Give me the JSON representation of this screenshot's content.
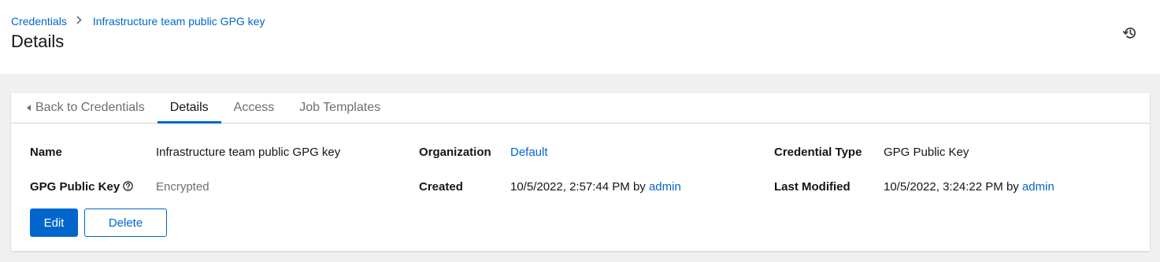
{
  "breadcrumb": {
    "root": "Credentials",
    "current": "Infrastructure team public GPG key"
  },
  "page_title": "Details",
  "tabs": [
    {
      "label": "Back to Credentials",
      "active": false
    },
    {
      "label": "Details",
      "active": true
    },
    {
      "label": "Access",
      "active": false
    },
    {
      "label": "Job Templates",
      "active": false
    }
  ],
  "details": {
    "name_label": "Name",
    "name_value": "Infrastructure team public GPG key",
    "organization_label": "Organization",
    "organization_value": "Default",
    "credential_type_label": "Credential Type",
    "credential_type_value": "GPG Public Key",
    "gpg_key_label": "GPG Public Key",
    "gpg_key_value": "Encrypted",
    "created_label": "Created",
    "created_date": "10/5/2022, 2:57:44 PM",
    "created_by": "by",
    "created_user": "admin",
    "modified_label": "Last Modified",
    "modified_date": "10/5/2022, 3:24:22 PM",
    "modified_by": "by",
    "modified_user": "admin"
  },
  "actions": {
    "edit_label": "Edit",
    "delete_label": "Delete"
  },
  "icons": {
    "history": "history-icon",
    "help": "question-circle-icon",
    "back": "caret-left-icon",
    "breadcrumb_separator": "angle-right-icon"
  },
  "colors": {
    "link": "#0066cc",
    "primary": "#0066cc",
    "muted": "#6a6e73",
    "background": "#f0f0f0"
  }
}
